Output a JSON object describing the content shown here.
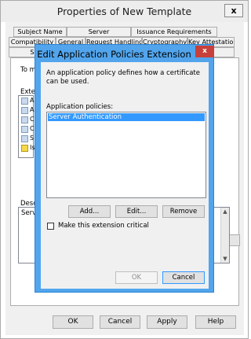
{
  "outer_dialog": {
    "title": "Properties of New Template",
    "close_label": "x",
    "tabs_row1": [
      "Subject Name",
      "Server",
      "Issuance Requirements"
    ],
    "tabs_row2": [
      "Compatibility",
      "General",
      "Request Handling",
      "Cryptography",
      "Key Attestation"
    ],
    "tabs_row3": [
      "S",
      "y"
    ],
    "partial_text": {
      "to_m": "To m",
      "exten": "Exten",
      "desc": "Desc",
      "serv": "Serv"
    },
    "partial_list_letters": [
      "A",
      "A",
      "C",
      "C",
      "S",
      "Is"
    ],
    "buttons": {
      "ok": "OK",
      "cancel": "Cancel",
      "apply": "Apply",
      "help": "Help"
    }
  },
  "inner_dialog": {
    "title": "Edit Application Policies Extension",
    "close_label": "x",
    "intro_text": "An application policy defines how a certificate can be used.",
    "list_label": "Application policies:",
    "policies": [
      "Server Authentication"
    ],
    "buttons": {
      "add": "Add...",
      "edit": "Edit...",
      "remove": "Remove",
      "ok": "OK",
      "cancel": "Cancel"
    },
    "critical_checkbox_label": "Make this extension critical",
    "critical_checked": false
  },
  "colors": {
    "inner_frame": "#52a5ec",
    "close_red": "#c7403a",
    "selection": "#3399ff",
    "dialog_bg": "#f0f0f0"
  }
}
